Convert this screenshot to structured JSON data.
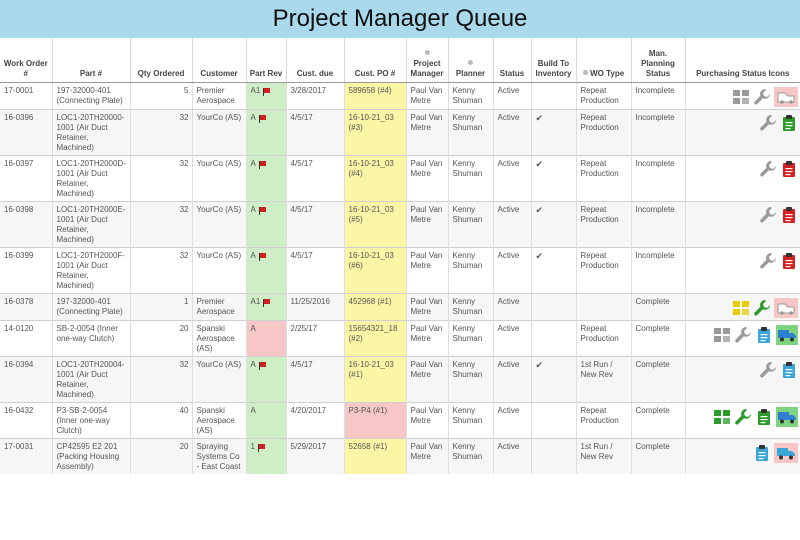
{
  "title": "Project Manager Queue",
  "headers": {
    "wo": "Work Order #",
    "part": "Part #",
    "qty": "Qty Ordered",
    "customer": "Customer",
    "rev": "Part Rev",
    "due": "Cust. due",
    "po": "Cust. PO #",
    "pm": "Project Manager",
    "planner": "Planner",
    "status": "Status",
    "bti": "Build To Inventory",
    "wotype": "WO Type",
    "planning": "Man. Planning Status",
    "icons": "Purchasing Status Icons"
  },
  "rows": [
    {
      "wo": "17-0001",
      "part": "197-32000-401 (Connecting Plate)",
      "qty": "5",
      "customer": "Premier Aerospace",
      "rev": "A1",
      "rev_flag": true,
      "rev_bg": "green",
      "due": "3/28/2017",
      "po": "589658 (#4)",
      "po_bg": "yellow",
      "pm": "Paul Van Metre",
      "planner": "Kenny Shuman",
      "status": "Active",
      "bti": "",
      "wotype": "Repeat Production",
      "planning": "Incomplete",
      "icons": [
        "material-grey",
        "wrench-grey",
        "outsource-pink"
      ]
    },
    {
      "wo": "16-0396",
      "part": "LOC1-20TH20000-1001 (Air Duct Retainer, Machined)",
      "qty": "32",
      "customer": "YourCo (AS)",
      "rev": "A",
      "rev_flag": true,
      "rev_bg": "green",
      "due": "4/5/17",
      "po": "16-10-21_03 (#3)",
      "po_bg": "yellow",
      "pm": "Paul Van Metre",
      "planner": "Kenny Shuman",
      "status": "Active",
      "bti": "✔",
      "wotype": "Repeat Production",
      "planning": "Incomplete",
      "icons": [
        "wrench-grey",
        "clipboard-green"
      ]
    },
    {
      "wo": "16-0397",
      "part": "LOC1-20TH2000D-1001 (Air Duct Retainer, Machined)",
      "qty": "32",
      "customer": "YourCo (AS)",
      "rev": "A",
      "rev_flag": true,
      "rev_bg": "green",
      "due": "4/5/17",
      "po": "16-10-21_03 (#4)",
      "po_bg": "yellow",
      "pm": "Paul Van Metre",
      "planner": "Kenny Shuman",
      "status": "Active",
      "bti": "✔",
      "wotype": "Repeat Production",
      "planning": "Incomplete",
      "icons": [
        "wrench-grey",
        "clipboard-red"
      ]
    },
    {
      "wo": "16-0398",
      "part": "LOC1-20TH2000E-1001 (Air Duct Retainer, Machined)",
      "qty": "32",
      "customer": "YourCo (AS)",
      "rev": "A",
      "rev_flag": true,
      "rev_bg": "green",
      "due": "4/5/17",
      "po": "16-10-21_03 (#5)",
      "po_bg": "yellow",
      "pm": "Paul Van Metre",
      "planner": "Kenny Shuman",
      "status": "Active",
      "bti": "✔",
      "wotype": "Repeat Production",
      "planning": "Incomplete",
      "icons": [
        "wrench-grey",
        "clipboard-red"
      ]
    },
    {
      "wo": "16-0399",
      "part": "LOC1-20TH2000F-1001 (Air Duct Retainer, Machined)",
      "qty": "32",
      "customer": "YourCo (AS)",
      "rev": "A",
      "rev_flag": true,
      "rev_bg": "green",
      "due": "4/5/17",
      "po": "16-10-21_03 (#6)",
      "po_bg": "yellow",
      "pm": "Paul Van Metre",
      "planner": "Kenny Shuman",
      "status": "Active",
      "bti": "✔",
      "wotype": "Repeat Production",
      "planning": "Incomplete",
      "icons": [
        "wrench-grey",
        "clipboard-red"
      ]
    },
    {
      "wo": "16-0378",
      "part": "197-32000-401 (Connecting Plate)",
      "qty": "1",
      "customer": "Premier Aerospace",
      "rev": "A1",
      "rev_flag": true,
      "rev_bg": "green",
      "due": "11/25/2016",
      "po": "452968 (#1)",
      "po_bg": "yellow",
      "pm": "Paul Van Metre",
      "planner": "Kenny Shuman",
      "status": "Active",
      "bti": "",
      "wotype": "",
      "planning": "Complete",
      "icons": [
        "material-yellow",
        "wrench-green",
        "outsource-pink"
      ]
    },
    {
      "wo": "14-0120",
      "part": "SB-2-0054 (Inner one-way Clutch)",
      "qty": "20",
      "customer": "Spanski Aerospace (AS)",
      "rev": "A",
      "rev_flag": false,
      "rev_bg": "red",
      "due": "2/25/17",
      "po": "15654321_18 (#2)",
      "po_bg": "yellow",
      "pm": "Paul Van Metre",
      "planner": "Kenny Shuman",
      "status": "Active",
      "bti": "",
      "wotype": "Repeat Production",
      "planning": "Complete",
      "icons": [
        "material-grey",
        "wrench-grey",
        "clipboard-blue",
        "truck-green"
      ]
    },
    {
      "wo": "16-0394",
      "part": "LOC1-20TH20004-1001 (Air Duct Retainer, Machined)",
      "qty": "32",
      "customer": "YourCo (AS)",
      "rev": "A",
      "rev_flag": true,
      "rev_bg": "green",
      "due": "4/5/17",
      "po": "16-10-21_03 (#1)",
      "po_bg": "yellow",
      "pm": "Paul Van Metre",
      "planner": "Kenny Shuman",
      "status": "Active",
      "bti": "✔",
      "wotype": "1st Run / New Rev",
      "planning": "Complete",
      "icons": [
        "wrench-grey",
        "clipboard-blue"
      ]
    },
    {
      "wo": "16-0432",
      "part": "P3-SB-2-0054 (Inner one-way Clutch)",
      "qty": "40",
      "customer": "Spanski Aerospace (AS)",
      "rev": "A",
      "rev_flag": false,
      "rev_bg": "green",
      "due": "4/20/2017",
      "po": "P3-P4 (#1)",
      "po_bg": "pink",
      "pm": "Paul Van Metre",
      "planner": "Kenny Shuman",
      "status": "Active",
      "bti": "",
      "wotype": "Repeat Production",
      "planning": "Complete",
      "icons": [
        "material-green",
        "wrench-green",
        "clipboard-green",
        "truck-green"
      ]
    },
    {
      "wo": "17-0031",
      "part": "CP42595 E2 201 (Packing Housing Assembly)",
      "qty": "20",
      "customer": "Spraying Systems Co - East Coast",
      "rev": "1",
      "rev_flag": true,
      "rev_bg": "green",
      "due": "5/29/2017",
      "po": "52658 (#1)",
      "po_bg": "yellow",
      "pm": "Paul Van Metre",
      "planner": "Kenny Shuman",
      "status": "Active",
      "bti": "",
      "wotype": "1st Run / New Rev",
      "planning": "Complete",
      "icons": [
        "clipboard-blue",
        "truck-pink"
      ]
    }
  ],
  "colors": {
    "header_bg": "#a9d9ea",
    "link": "#2a5db0",
    "rev_ok": "#cdeec7",
    "rev_bad": "#f7c7c7",
    "po_yellow": "#fbf6a6",
    "po_pink": "#f7c7c7",
    "icon_green": "#2e9a2e",
    "icon_red": "#d42020",
    "icon_blue": "#3aa6d8",
    "icon_yellow": "#e9cc00"
  }
}
